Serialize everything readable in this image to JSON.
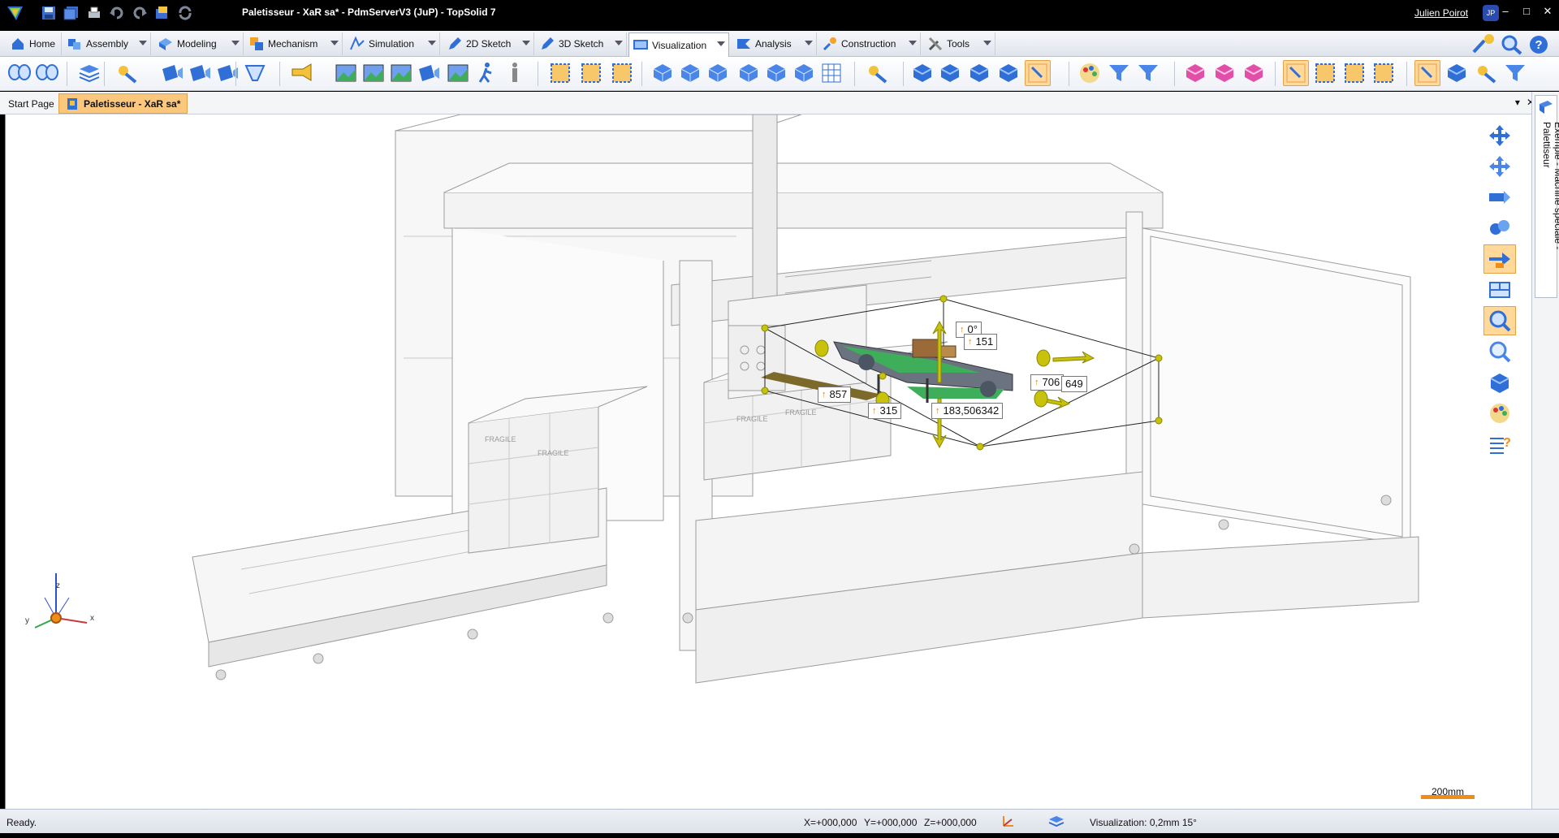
{
  "window": {
    "title": "Paletisseur - XaR sa* - PdmServerV3 (JuP) - TopSolid 7",
    "user": "Julien Poirot",
    "user_initials": "JP"
  },
  "ribbon": {
    "tabs": [
      {
        "label": "Home",
        "icon": "home-icon"
      },
      {
        "label": "Assembly",
        "icon": "assembly-icon"
      },
      {
        "label": "Modeling",
        "icon": "modeling-icon"
      },
      {
        "label": "Mechanism",
        "icon": "mechanism-icon"
      },
      {
        "label": "Simulation",
        "icon": "simulation-icon"
      },
      {
        "label": "2D Sketch",
        "icon": "pencil-icon"
      },
      {
        "label": "3D Sketch",
        "icon": "pencil-icon"
      },
      {
        "label": "Visualization",
        "icon": "monitor-icon",
        "active": true
      },
      {
        "label": "Analysis",
        "icon": "analysis-icon"
      },
      {
        "label": "Construction",
        "icon": "construction-icon"
      },
      {
        "label": "Tools",
        "icon": "tools-icon"
      }
    ]
  },
  "documents": {
    "tabs": [
      {
        "label": "Start Page"
      },
      {
        "label": "Paletisseur - XaR sa*",
        "active": true
      }
    ],
    "close_glyph": "✕"
  },
  "side_panel": {
    "title": "Exemple - Machine spéciale - Palettiseur"
  },
  "viewport": {
    "dimensions": {
      "d857": "857",
      "d0": "0°",
      "d151": "151",
      "d706": "706",
      "d649": "649",
      "d315": "315",
      "d183": "183,506342"
    },
    "axes": {
      "z": "z",
      "y": "y",
      "x": "x"
    },
    "scale": "200mm",
    "box_labels": [
      "FRAGILE",
      "FRAGILE",
      "FRAGILE",
      "FRAGILE"
    ]
  },
  "status": {
    "message": "Ready.",
    "x": "X=+000,000",
    "y": "Y=+000,000",
    "z": "Z=+000,000",
    "visualization": "Visualization: 0,2mm 15°"
  },
  "colors": {
    "accent_orange": "#f08c1a",
    "handle_yellow": "#c8c20a",
    "conveyor_green": "#3fae5a",
    "selected_bg": "#ffd89a"
  }
}
